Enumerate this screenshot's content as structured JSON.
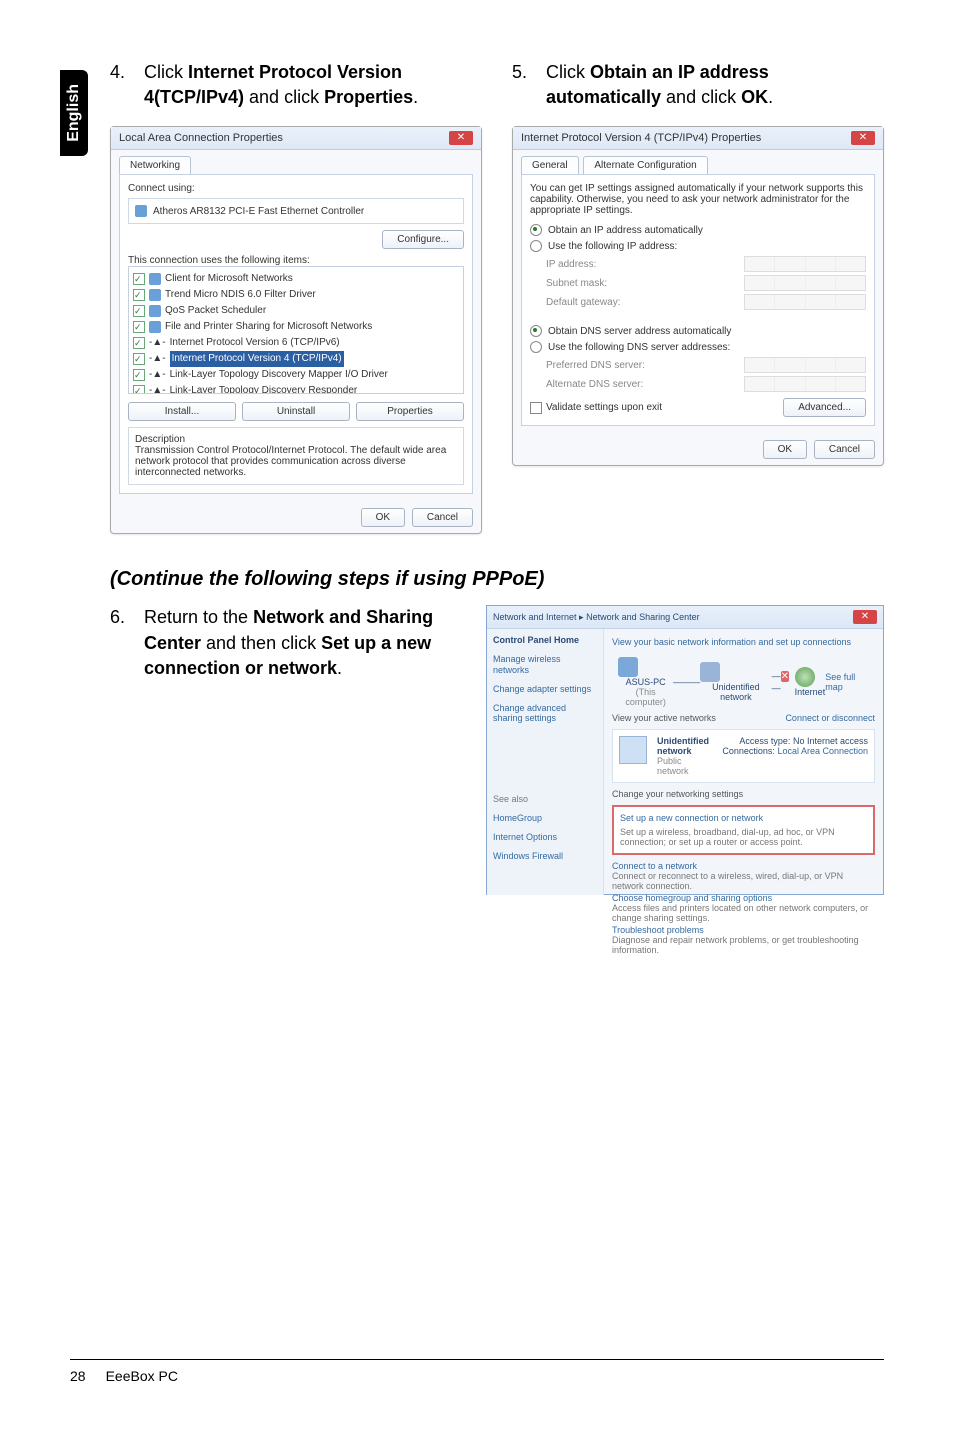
{
  "sidebar_lang": "English",
  "step4": {
    "num": "4.",
    "pre": "Click ",
    "b1": "Internet Protocol Version 4(TCP/IPv4)",
    "mid": " and click ",
    "b2": "Properties",
    "post": "."
  },
  "step5": {
    "num": "5.",
    "pre": "Click ",
    "b1": "Obtain an IP address automatically",
    "mid": " and click ",
    "b2": "OK",
    "post": "."
  },
  "section_heading": "(Continue the following steps if using PPPoE)",
  "step6": {
    "num": "6.",
    "pre": "Return to the ",
    "b1": "Network and Sharing Center",
    "mid": " and then click ",
    "b2": "Set up a new connection or network",
    "post": "."
  },
  "dlg1": {
    "title": "Local Area Connection Properties",
    "tab": "Networking",
    "connect_using": "Connect using:",
    "adapter": "Atheros AR8132 PCI-E Fast Ethernet Controller",
    "configure": "Configure...",
    "uses": "This connection uses the following items:",
    "items": [
      "Client for Microsoft Networks",
      "Trend Micro NDIS 6.0 Filter Driver",
      "QoS Packet Scheduler",
      "File and Printer Sharing for Microsoft Networks",
      "Internet Protocol Version 6 (TCP/IPv6)",
      "Internet Protocol Version 4 (TCP/IPv4)",
      "Link-Layer Topology Discovery Mapper I/O Driver",
      "Link-Layer Topology Discovery Responder"
    ],
    "install": "Install...",
    "uninstall": "Uninstall",
    "properties": "Properties",
    "desc_label": "Description",
    "desc_text": "Transmission Control Protocol/Internet Protocol. The default wide area network protocol that provides communication across diverse interconnected networks.",
    "ok": "OK",
    "cancel": "Cancel"
  },
  "dlg2": {
    "title": "Internet Protocol Version 4 (TCP/IPv4) Properties",
    "tab1": "General",
    "tab2": "Alternate Configuration",
    "explain": "You can get IP settings assigned automatically if your network supports this capability. Otherwise, you need to ask your network administrator for the appropriate IP settings.",
    "r1": "Obtain an IP address automatically",
    "r2": "Use the following IP address:",
    "ip": "IP address:",
    "mask": "Subnet mask:",
    "gw": "Default gateway:",
    "r3": "Obtain DNS server address automatically",
    "r4": "Use the following DNS server addresses:",
    "pref": "Preferred DNS server:",
    "alt": "Alternate DNS server:",
    "validate": "Validate settings upon exit",
    "advanced": "Advanced...",
    "ok": "OK",
    "cancel": "Cancel"
  },
  "win": {
    "breadcrumb": "Network and Internet  ▸  Network and Sharing Center",
    "side_heading": "Control Panel Home",
    "side_items": [
      "Manage wireless networks",
      "Change adapter settings",
      "Change advanced sharing settings"
    ],
    "see_also": "See also",
    "see_also_items": [
      "HomeGroup",
      "Internet Options",
      "Windows Firewall"
    ],
    "lead": "View your basic network information and set up connections",
    "full_map": "See full map",
    "node_pc": "ASUS-PC",
    "node_pc_sub": "(This computer)",
    "node_net": "Unidentified network",
    "node_internet": "Internet",
    "view_active": "View your active networks",
    "connect_disconnect": "Connect or disconnect",
    "unid": "Unidentified network",
    "pubnet": "Public network",
    "access": "Access type:",
    "noaccess": "No Internet access",
    "connections": "Connections:",
    "lac": "Local Area Connection",
    "change_settings": "Change your networking settings",
    "opt1_t": "Set up a new connection or network",
    "opt1_d": "Set up a wireless, broadband, dial-up, ad hoc, or VPN connection; or set up a router or access point.",
    "opt2_t": "Connect to a network",
    "opt2_d": "Connect or reconnect to a wireless, wired, dial-up, or VPN network connection.",
    "opt3_t": "Choose homegroup and sharing options",
    "opt3_d": "Access files and printers located on other network computers, or change sharing settings.",
    "opt4_t": "Troubleshoot problems",
    "opt4_d": "Diagnose and repair network problems, or get troubleshooting information."
  },
  "footer": {
    "page": "28",
    "product": "EeeBox PC"
  }
}
